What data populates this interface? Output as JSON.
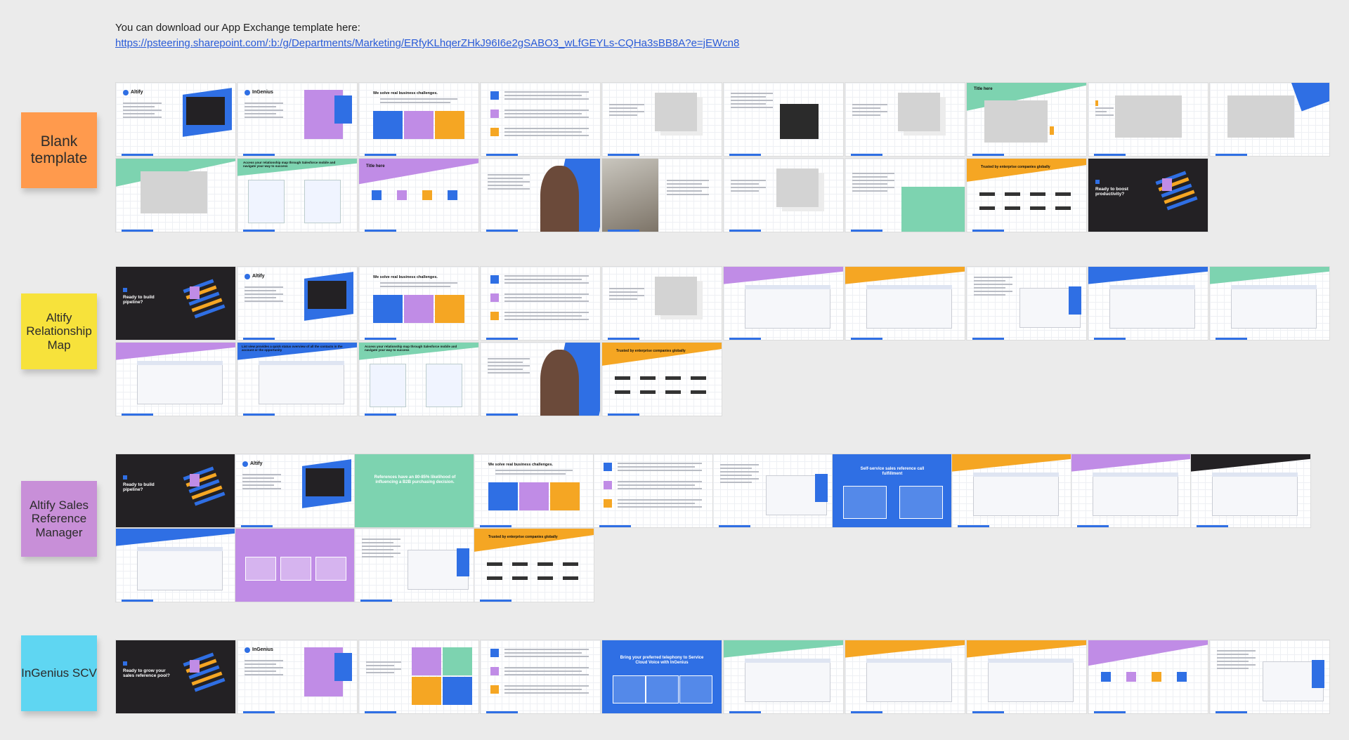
{
  "header": {
    "intro_text": "You can download our App Exchange template here:",
    "link_text": "https://psteering.sharepoint.com/:b:/g/Departments/Marketing/ERfyKLhqerZHkJ96I6e2gSABO3_wLfGEYLs-CQHa3sBB8A?e=jEWcn8"
  },
  "stickies": [
    {
      "label": "Blank template",
      "color": "#ff9a4d"
    },
    {
      "label": "Altify Relationship Map",
      "color": "#f7e23b"
    },
    {
      "label": "Altify Sales Reference Manager",
      "color": "#c88fd8"
    },
    {
      "label": "InGenius SCV",
      "color": "#5fd6f2"
    }
  ],
  "colors": {
    "blue": "#2f6fe4",
    "mint": "#7dd3b0",
    "purple": "#c08ce6",
    "orange": "#f5a623",
    "dark": "#232124"
  },
  "slide_text": {
    "altify": "Altify",
    "ingenius": "InGenius",
    "we_solve": "We solve real business challenges.",
    "title_here": "Title here",
    "ready_boost": "Ready to boost productivity?",
    "ready_pipeline": "Ready to build pipeline?",
    "ready_grow": "Ready to grow your sales reference pool?",
    "trusted": "Trusted by enterprise companies globally",
    "references_stat": "References have an 80-85% likelihood of influencing a B2B purchasing decision.",
    "bring_telephony": "Bring your preferred telephony to Service Cloud Voice with InGenius",
    "self_service": "Self-service sales reference call fulfillment",
    "list_view": "List view provides a quick status overview of all the contacts in the account or the opportunity",
    "access_map": "Access your relationship map through Salesforce mobile and navigate your way to success"
  }
}
